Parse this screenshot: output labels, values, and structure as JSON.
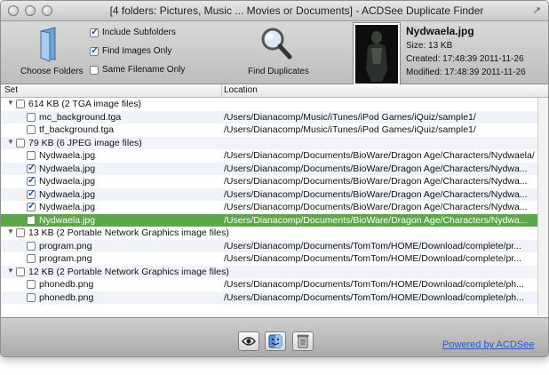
{
  "window": {
    "title": "[4 folders: Pictures, Music ... Movies or Documents] - ACDSee Duplicate Finder"
  },
  "toolbar": {
    "choose_folders_label": "Choose Folders",
    "find_duplicates_label": "Find Duplicates",
    "options": [
      {
        "label": "Include Subfolders",
        "checked": true
      },
      {
        "label": "Find Images Only",
        "checked": true
      },
      {
        "label": "Same Filename Only",
        "checked": false
      }
    ]
  },
  "preview": {
    "filename": "Nydwaela.jpg",
    "size": "Size: 13 KB",
    "created": "Created: 17:48:39 2011-11-26",
    "modified": "Modified: 17:48:39 2011-11-26"
  },
  "columns": {
    "set": "Set",
    "location": "Location"
  },
  "groups": [
    {
      "label": "614 KB (2 TGA image files)",
      "files": [
        {
          "name": "mc_background.tga",
          "location": "/Users/Dianacomp/Music/iTunes/iPod Games/iQuiz/sample1/",
          "checked": false,
          "selected": false
        },
        {
          "name": "tf_background.tga",
          "location": "/Users/Dianacomp/Music/iTunes/iPod Games/iQuiz/sample1/",
          "checked": false,
          "selected": false
        }
      ]
    },
    {
      "label": "79 KB (6 JPEG image files)",
      "files": [
        {
          "name": "Nydwaela.jpg",
          "location": "/Users/Dianacomp/Documents/BioWare/Dragon Age/Characters/Nydwaela/",
          "checked": false,
          "selected": false
        },
        {
          "name": "Nydwaela.jpg",
          "location": "/Users/Dianacomp/Documents/BioWare/Dragon Age/Characters/Nydwa...",
          "checked": true,
          "selected": false
        },
        {
          "name": "Nydwaela.jpg",
          "location": "/Users/Dianacomp/Documents/BioWare/Dragon Age/Characters/Nydwa...",
          "checked": true,
          "selected": false
        },
        {
          "name": "Nydwaela.jpg",
          "location": "/Users/Dianacomp/Documents/BioWare/Dragon Age/Characters/Nydwa...",
          "checked": true,
          "selected": false
        },
        {
          "name": "Nydwaela.jpg",
          "location": "/Users/Dianacomp/Documents/BioWare/Dragon Age/Characters/Nydwa...",
          "checked": true,
          "selected": false
        },
        {
          "name": "Nydwaela.jpg",
          "location": "/Users/Dianacomp/Documents/BioWare/Dragon Age/Characters/Nydwa...",
          "checked": true,
          "selected": true
        }
      ]
    },
    {
      "label": "13 KB (2 Portable Network Graphics image files)",
      "files": [
        {
          "name": "program.png",
          "location": "/Users/Dianacomp/Documents/TomTom/HOME/Download/complete/pr...",
          "checked": false,
          "selected": false
        },
        {
          "name": "program.png",
          "location": "/Users/Dianacomp/Documents/TomTom/HOME/Download/complete/pr...",
          "checked": false,
          "selected": false
        }
      ]
    },
    {
      "label": "12 KB (2 Portable Network Graphics image files)",
      "files": [
        {
          "name": "phonedb.png",
          "location": "/Users/Dianacomp/Documents/TomTom/HOME/Download/complete/ph...",
          "checked": false,
          "selected": false
        },
        {
          "name": "phonedb.png",
          "location": "/Users/Dianacomp/Documents/TomTom/HOME/Download/complete/ph...",
          "checked": false,
          "selected": false
        }
      ]
    }
  ],
  "footer": {
    "powered_by": "Powered by ACDSee"
  },
  "colors": {
    "selection": "#5aa846",
    "link": "#2a5bd0",
    "check": "#1a4fa8"
  },
  "icons": [
    "folder-icon",
    "magnifier-icon",
    "eye-icon",
    "finder-icon",
    "trash-icon"
  ]
}
